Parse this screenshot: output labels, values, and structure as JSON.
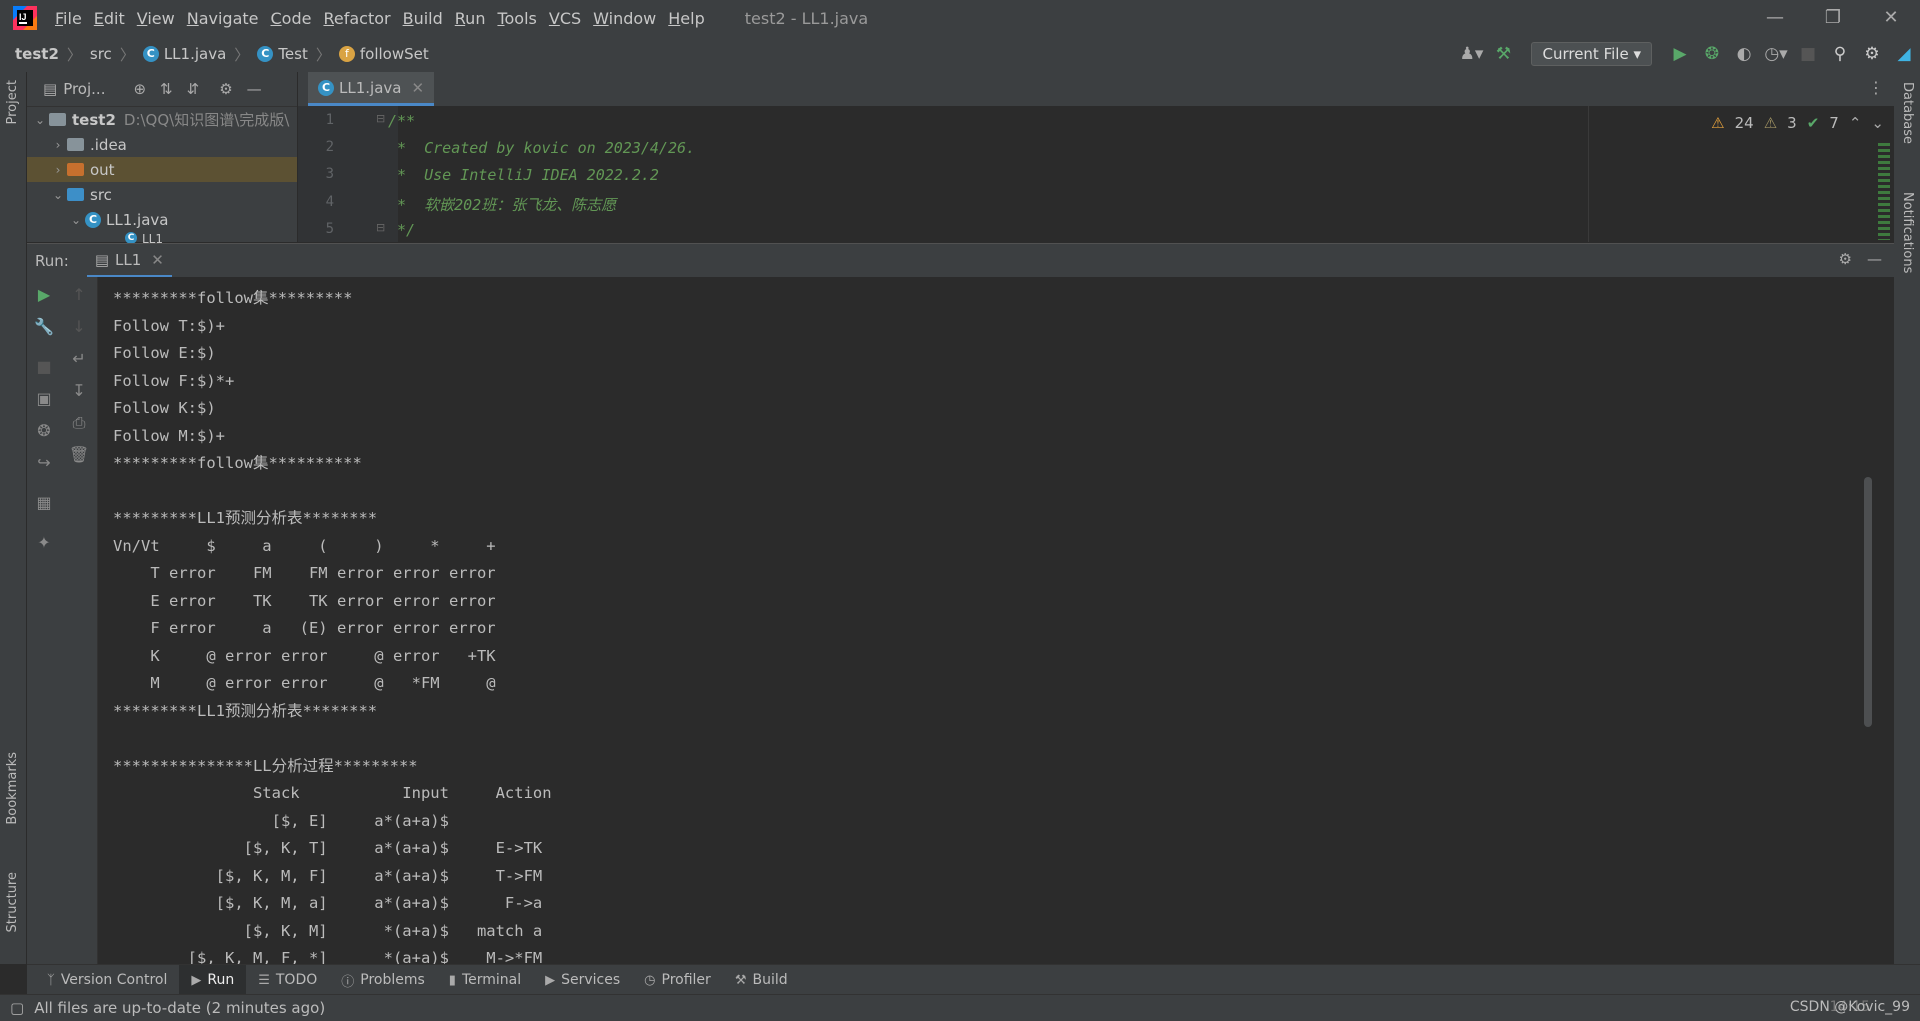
{
  "app": {
    "window_title": "test2 - LL1.java"
  },
  "menu": [
    "File",
    "Edit",
    "View",
    "Navigate",
    "Code",
    "Refactor",
    "Build",
    "Run",
    "Tools",
    "VCS",
    "Window",
    "Help"
  ],
  "breadcrumbs": {
    "project": "test2",
    "src": "src",
    "file": "LL1.java",
    "class": "Test",
    "method": "followSet"
  },
  "toolbar": {
    "run_config": "Current File"
  },
  "project_panel": {
    "title": "Proj...",
    "tree": [
      {
        "label": "test2",
        "detail": "D:\\QQ\\知识图谱\\完成版\\",
        "icon": "module"
      },
      {
        "label": ".idea",
        "icon": "folder"
      },
      {
        "label": "out",
        "icon": "folder-orange"
      },
      {
        "label": "src",
        "icon": "folder-blue"
      },
      {
        "label": "LL1.java",
        "icon": "class"
      },
      {
        "label": "LL1",
        "icon": "class"
      }
    ]
  },
  "left_stripe": {
    "project": "Project",
    "bookmarks": "Bookmarks",
    "structure": "Structure"
  },
  "right_stripe": {
    "database": "Database",
    "notifications": "Notifications"
  },
  "editor": {
    "tab": "LL1.java",
    "inspections": {
      "warnings": "24",
      "weak_warnings": "3",
      "ok": "7"
    },
    "lines": [
      {
        "n": "1",
        "text": "/**"
      },
      {
        "n": "2",
        "text": " *  Created by kovic on 2023/4/26."
      },
      {
        "n": "3",
        "text": " *  Use IntelliJ IDEA 2022.2.2"
      },
      {
        "n": "4",
        "text": " *  软嵌202班：张飞龙、陈志愿"
      },
      {
        "n": "5",
        "text": " */"
      }
    ]
  },
  "run_panel": {
    "label": "Run:",
    "tab": "LL1",
    "output": "*********follow集*********\nFollow T:$)+\nFollow E:$)\nFollow F:$)*+\nFollow K:$)\nFollow M:$)+\n*********follow集**********\n\n*********LL1预测分析表********\nVn/Vt     $     a     (     )     *     +\n    T error    FM    FM error error error\n    E error    TK    TK error error error\n    F error     a   (E) error error error\n    K     @ error error     @ error   +TK\n    M     @ error error     @   *FM     @\n*********LL1预测分析表********\n\n***************LL分析过程*********\n               Stack           Input     Action\n                 [$, E]     a*(a+a)$\n              [$, K, T]     a*(a+a)$     E->TK\n           [$, K, M, F]     a*(a+a)$     T->FM\n           [$, K, M, a]     a*(a+a)$      F->a\n              [$, K, M]      *(a+a)$   match a\n        [$, K, M, F, *]      *(a+a)$    M->*FM"
  },
  "bottom_tabs": [
    "Version Control",
    "Run",
    "TODO",
    "Problems",
    "Terminal",
    "Services",
    "Profiler",
    "Build"
  ],
  "status": {
    "message": "All files are up-to-date (2 minutes ago)",
    "position": "14:15",
    "watermark": "CSDN @Kovic_99"
  }
}
